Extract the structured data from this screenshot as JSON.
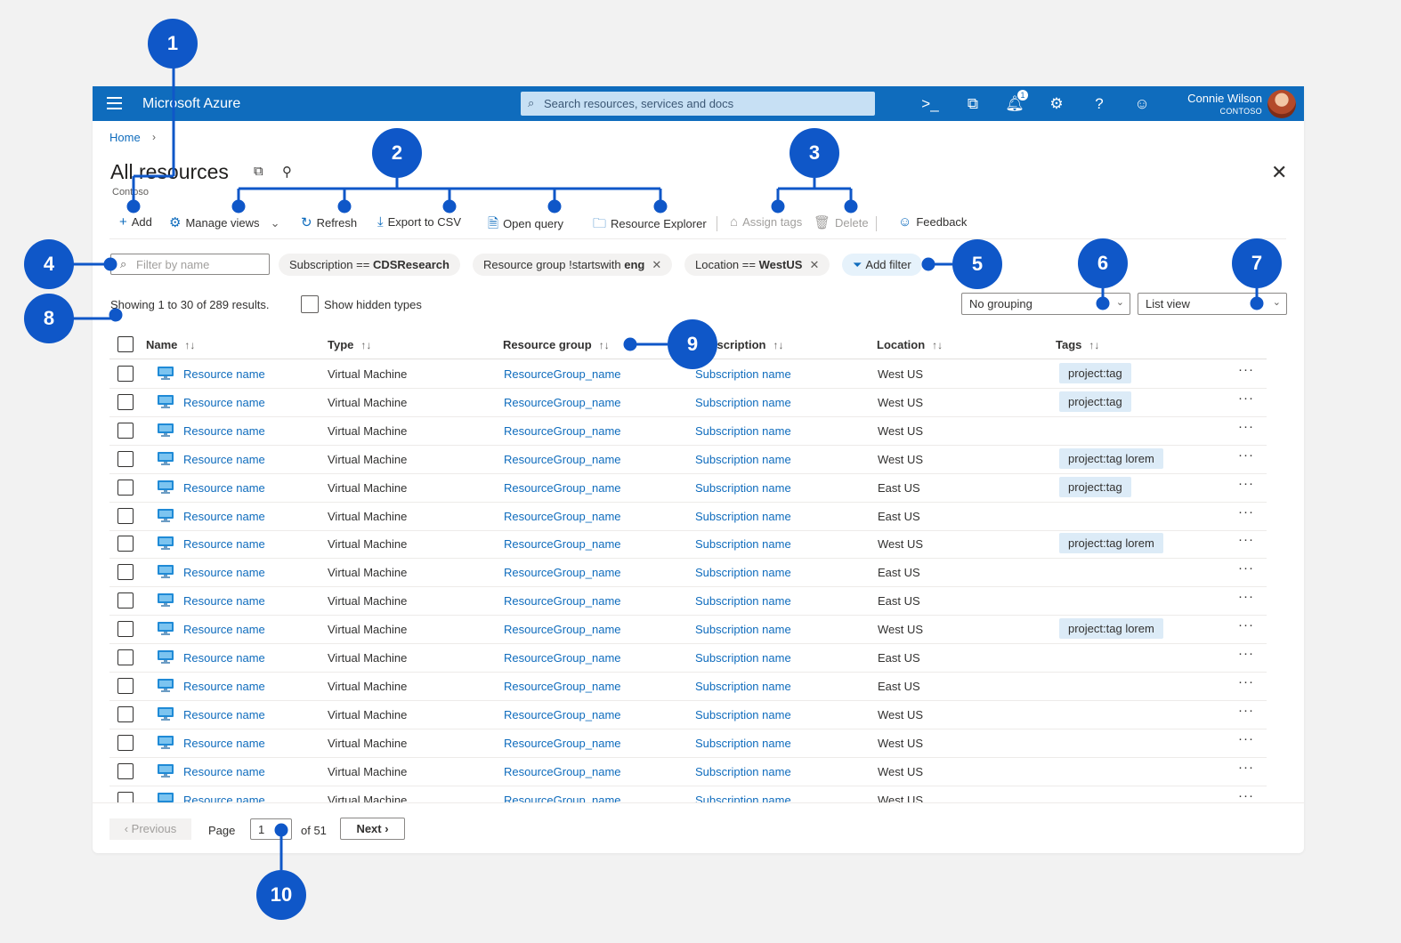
{
  "topbar": {
    "brand": "Microsoft Azure",
    "search_placeholder": "Search resources, services and docs",
    "notification_count": "1",
    "user_name": "Connie Wilson",
    "user_org": "CONTOSO"
  },
  "breadcrumb": {
    "home": "Home"
  },
  "page": {
    "title": "All resources",
    "subtitle": "Contoso"
  },
  "commands": {
    "add": "Add",
    "manage_views": "Manage views",
    "refresh": "Refresh",
    "export_csv": "Export to CSV",
    "open_query": "Open query",
    "resource_explorer": "Resource Explorer",
    "assign_tags": "Assign tags",
    "delete": "Delete",
    "feedback": "Feedback"
  },
  "filters": {
    "name_placeholder": "Filter by name",
    "subscription": {
      "prefix": "Subscription == ",
      "value": "CDSResearch"
    },
    "resource_group": {
      "prefix": "Resource group !startswith ",
      "value": "eng"
    },
    "location": {
      "prefix": "Location == ",
      "value": "WestUS"
    },
    "add_filter": "Add filter"
  },
  "results": {
    "showing": "Showing 1 to 30 of 289 results.",
    "show_hidden": "Show hidden types",
    "grouping": "No grouping",
    "view": "List view"
  },
  "table": {
    "columns": [
      "Name",
      "Type",
      "Resource group",
      "Subscription",
      "Location",
      "Tags"
    ],
    "rows": [
      {
        "name": "Resource name",
        "type": "Virtual Machine",
        "rg": "ResourceGroup_name",
        "sub": "Subscription name",
        "loc": "West US",
        "tag": "project:tag"
      },
      {
        "name": "Resource name",
        "type": "Virtual Machine",
        "rg": "ResourceGroup_name",
        "sub": "Subscription name",
        "loc": "West US",
        "tag": "project:tag"
      },
      {
        "name": "Resource name",
        "type": "Virtual Machine",
        "rg": "ResourceGroup_name",
        "sub": "Subscription name",
        "loc": "West US",
        "tag": ""
      },
      {
        "name": "Resource name",
        "type": "Virtual Machine",
        "rg": "ResourceGroup_name",
        "sub": "Subscription name",
        "loc": "West US",
        "tag": "project:tag lorem"
      },
      {
        "name": "Resource name",
        "type": "Virtual Machine",
        "rg": "ResourceGroup_name",
        "sub": "Subscription name",
        "loc": "East US",
        "tag": "project:tag"
      },
      {
        "name": "Resource name",
        "type": "Virtual Machine",
        "rg": "ResourceGroup_name",
        "sub": "Subscription name",
        "loc": "East US",
        "tag": ""
      },
      {
        "name": "Resource name",
        "type": "Virtual Machine",
        "rg": "ResourceGroup_name",
        "sub": "Subscription name",
        "loc": "West US",
        "tag": "project:tag lorem"
      },
      {
        "name": "Resource name",
        "type": "Virtual Machine",
        "rg": "ResourceGroup_name",
        "sub": "Subscription name",
        "loc": "East US",
        "tag": ""
      },
      {
        "name": "Resource name",
        "type": "Virtual Machine",
        "rg": "ResourceGroup_name",
        "sub": "Subscription name",
        "loc": "East US",
        "tag": ""
      },
      {
        "name": "Resource name",
        "type": "Virtual Machine",
        "rg": "ResourceGroup_name",
        "sub": "Subscription name",
        "loc": "West US",
        "tag": "project:tag lorem"
      },
      {
        "name": "Resource name",
        "type": "Virtual Machine",
        "rg": "ResourceGroup_name",
        "sub": "Subscription name",
        "loc": "East US",
        "tag": ""
      },
      {
        "name": "Resource name",
        "type": "Virtual Machine",
        "rg": "ResourceGroup_name",
        "sub": "Subscription name",
        "loc": "East US",
        "tag": ""
      },
      {
        "name": "Resource name",
        "type": "Virtual Machine",
        "rg": "ResourceGroup_name",
        "sub": "Subscription name",
        "loc": "West US",
        "tag": ""
      },
      {
        "name": "Resource name",
        "type": "Virtual Machine",
        "rg": "ResourceGroup_name",
        "sub": "Subscription name",
        "loc": "West US",
        "tag": ""
      },
      {
        "name": "Resource name",
        "type": "Virtual Machine",
        "rg": "ResourceGroup_name",
        "sub": "Subscription name",
        "loc": "West US",
        "tag": ""
      },
      {
        "name": "Resource name",
        "type": "Virtual Machine",
        "rg": "ResourceGroup_name",
        "sub": "Subscription name",
        "loc": "West US",
        "tag": ""
      }
    ]
  },
  "pagination": {
    "previous": "‹ Previous",
    "page_label": "Page",
    "page_value": "1",
    "of_label": "of 51",
    "next": "Next ›"
  },
  "callouts": [
    "1",
    "2",
    "3",
    "4",
    "5",
    "6",
    "7",
    "8",
    "9",
    "10"
  ],
  "colors": {
    "brand": "#0f6cbd",
    "callout": "#0f57c8",
    "tag_bg": "#dcebf7"
  }
}
